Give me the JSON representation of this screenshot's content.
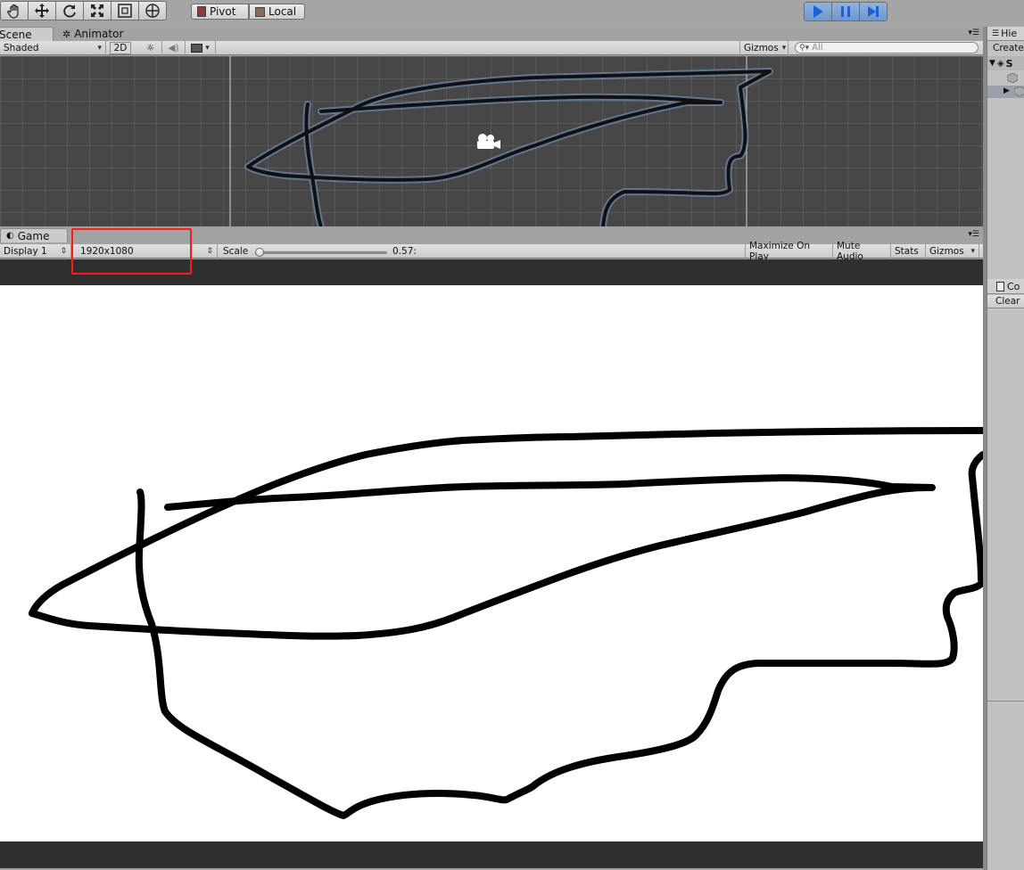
{
  "toolbar": {
    "tools": [
      "hand-tool",
      "move-tool",
      "rotate-tool",
      "scale-tool",
      "rect-tool",
      "transform-tool"
    ],
    "pivot_label": "Pivot",
    "local_label": "Local",
    "playback": {
      "play_active": true
    }
  },
  "scene": {
    "tab_label": "Scene",
    "animator_tab_label": "Animator",
    "shading_mode": "Shaded",
    "mode_2d_label": "2D",
    "gizmos_label": "Gizmos",
    "search_placeholder": "All"
  },
  "game": {
    "tab_label": "Game",
    "display": "Display 1",
    "resolution": "1920x1080",
    "scale_label": "Scale",
    "scale_value": "0.57:",
    "scale_fraction": 0.0,
    "maximize_label": "Maximize On Play",
    "mute_label": "Mute Audio",
    "stats_label": "Stats",
    "gizmos_label": "Gizmos"
  },
  "hierarchy": {
    "tab_label": "Hie",
    "create_label": "Create",
    "scene_letter": "S"
  },
  "console": {
    "tab_label": "Co",
    "clear_label": "Clear"
  },
  "colors": {
    "play_active": "#2f6fd6",
    "highlight": "#ff1a1a",
    "stroke": "#000000",
    "scene_bg": "#474747"
  }
}
